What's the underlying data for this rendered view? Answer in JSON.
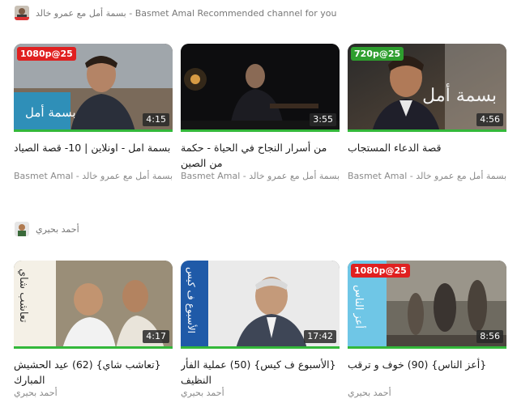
{
  "sections": [
    {
      "header_text": "بسمة أمل مع عمرو خالد - Basmet Amal  Recommended channel for you",
      "cards": [
        {
          "title": "قصة الدعاء المستجاب",
          "channel": "بسمة أمل مع عمرو خالد - Basmet Amal",
          "duration": "4:56",
          "badge": "720p@25",
          "badge_color": "#2e9e2e",
          "watched_fraction": 1.0,
          "thumb_text": "بسمة أمل"
        },
        {
          "title": "من أسرار النجاح في الحياة - حكمة من الصين",
          "channel": "بسمة أمل مع عمرو خالد - Basmet Amal",
          "duration": "3:55",
          "badge": "",
          "badge_color": "",
          "watched_fraction": 1.0,
          "thumb_text": ""
        },
        {
          "title": "بسمة امل - اونلاين | 10- قصة الصياد",
          "channel": "بسمة أمل مع عمرو خالد - Basmet Amal",
          "duration": "4:15",
          "badge": "1080p@25",
          "badge_color": "#e02020",
          "watched_fraction": 1.0,
          "thumb_text": "بسمة أمل"
        }
      ]
    },
    {
      "header_text": "أحمد بحيري",
      "cards": [
        {
          "title": "{أعز الناس} (90) خوف و ترقب",
          "channel": "أحمد بحيري",
          "duration": "8:56",
          "badge": "1080p@25",
          "badge_color": "#e02020",
          "watched_fraction": 1.0,
          "thumb_text": "أعز الناس"
        },
        {
          "title": "{الأسبوع ف كيس} (50) عملية الفأر النظيف",
          "channel": "أحمد بحيري",
          "duration": "17:42",
          "badge": "",
          "badge_color": "",
          "watched_fraction": 1.0,
          "thumb_text": "الأسبوع ف كيس"
        },
        {
          "title": "{تعاشب شاي} (62) عيد الحشيش المبارك",
          "channel": "أحمد بحيري",
          "duration": "4:17",
          "badge": "",
          "badge_color": "",
          "watched_fraction": 1.0,
          "thumb_text": "تعاشب شاي"
        }
      ]
    }
  ],
  "colors": {
    "progress_watched": "#33b83a",
    "badge_red": "#e02020",
    "badge_green": "#2e9e2e"
  }
}
